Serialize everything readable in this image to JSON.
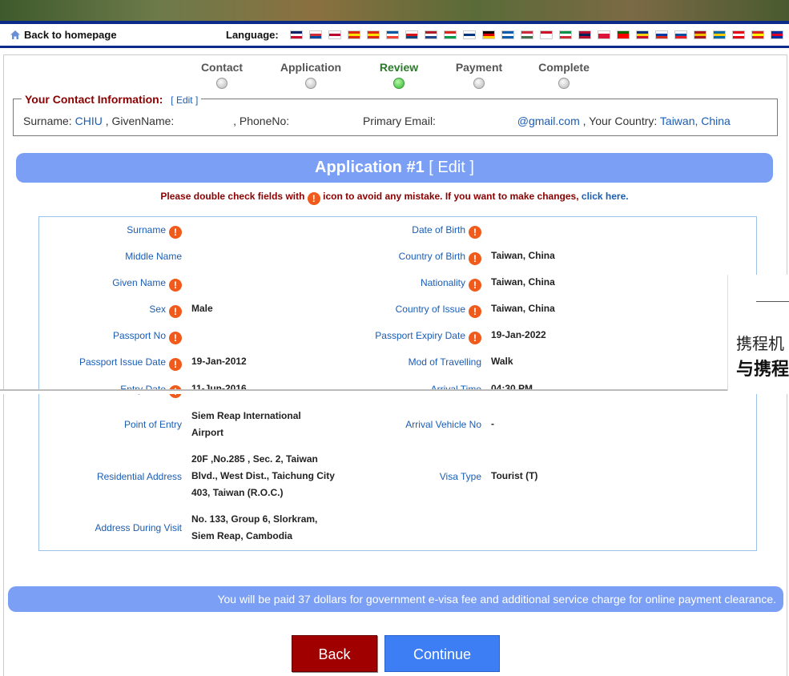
{
  "header": {
    "back_home": "Back to homepage",
    "language_label": "Language:",
    "flags": [
      {
        "name": "uk",
        "c": [
          "#012169",
          "#ffffff",
          "#c8102e"
        ]
      },
      {
        "name": "korea",
        "c": [
          "#ffffff",
          "#cd2e3a",
          "#0047a0"
        ]
      },
      {
        "name": "japan",
        "c": [
          "#ffffff",
          "#bc002d",
          "#ffffff"
        ]
      },
      {
        "name": "china",
        "c": [
          "#de2910",
          "#ffde00",
          "#de2910"
        ]
      },
      {
        "name": "china-traditional",
        "c": [
          "#de2910",
          "#ffde00",
          "#de2910"
        ]
      },
      {
        "name": "france",
        "c": [
          "#0055a4",
          "#ffffff",
          "#ef4135"
        ]
      },
      {
        "name": "czech",
        "c": [
          "#ffffff",
          "#d7141a",
          "#11457e"
        ]
      },
      {
        "name": "netherlands",
        "c": [
          "#ae1c28",
          "#ffffff",
          "#21468b"
        ]
      },
      {
        "name": "basque",
        "c": [
          "#d52b1e",
          "#ffffff",
          "#009b48"
        ]
      },
      {
        "name": "finland",
        "c": [
          "#ffffff",
          "#003580",
          "#ffffff"
        ]
      },
      {
        "name": "germany",
        "c": [
          "#000000",
          "#dd0000",
          "#ffce00"
        ]
      },
      {
        "name": "greece",
        "c": [
          "#0d5eaf",
          "#ffffff",
          "#0d5eaf"
        ]
      },
      {
        "name": "hungary",
        "c": [
          "#cd2a3e",
          "#ffffff",
          "#436f4d"
        ]
      },
      {
        "name": "indonesia",
        "c": [
          "#ce1126",
          "#ffffff",
          "#ffffff"
        ]
      },
      {
        "name": "italy",
        "c": [
          "#009246",
          "#ffffff",
          "#ce2b37"
        ]
      },
      {
        "name": "norway",
        "c": [
          "#ba0c2f",
          "#00205b",
          "#ba0c2f"
        ]
      },
      {
        "name": "poland",
        "c": [
          "#ffffff",
          "#dc143c",
          "#dc143c"
        ]
      },
      {
        "name": "portugal",
        "c": [
          "#006600",
          "#ff0000",
          "#ff0000"
        ]
      },
      {
        "name": "romania",
        "c": [
          "#002b7f",
          "#fcd116",
          "#ce1126"
        ]
      },
      {
        "name": "russia",
        "c": [
          "#ffffff",
          "#0039a6",
          "#d52b1e"
        ]
      },
      {
        "name": "slovakia",
        "c": [
          "#ffffff",
          "#0b4ea2",
          "#ee1c25"
        ]
      },
      {
        "name": "spain",
        "c": [
          "#aa151b",
          "#f1bf00",
          "#aa151b"
        ]
      },
      {
        "name": "sweden",
        "c": [
          "#006aa7",
          "#fecc00",
          "#006aa7"
        ]
      },
      {
        "name": "turkey",
        "c": [
          "#e30a17",
          "#ffffff",
          "#e30a17"
        ]
      },
      {
        "name": "vietnam",
        "c": [
          "#da251d",
          "#ffff00",
          "#da251d"
        ]
      },
      {
        "name": "cambodia",
        "c": [
          "#032ea1",
          "#e00025",
          "#032ea1"
        ]
      }
    ]
  },
  "steps": [
    "Contact",
    "Application",
    "Review",
    "Payment",
    "Complete"
  ],
  "contact": {
    "legend": "Your Contact Information:",
    "edit": "[ Edit ]",
    "surname_label": "Surname:",
    "surname": "CHIU",
    "given_label": ", GivenName:",
    "phone_label": ", PhoneNo:",
    "email_label": "Primary Email:",
    "email_domain": "@gmail.com",
    "country_label": ", Your Country:",
    "country": "Taiwan, China"
  },
  "application": {
    "title": "Application #1",
    "edit": "[ Edit ]",
    "notice_pre": "Please double check fields with",
    "notice_post": "icon to avoid any mistake. If you want to make changes,",
    "click_here": "click here.",
    "warn_glyph": "!"
  },
  "fields": {
    "surname": {
      "label": "Surname",
      "value": ""
    },
    "middle_name": {
      "label": "Middle Name",
      "value": ""
    },
    "given_name": {
      "label": "Given Name",
      "value": ""
    },
    "sex": {
      "label": "Sex",
      "value": "Male"
    },
    "passport_no": {
      "label": "Passport No",
      "value": ""
    },
    "passport_issue": {
      "label": "Passport Issue Date",
      "value": "19-Jan-2012"
    },
    "entry_date": {
      "label": "Entry Date",
      "value": "11-Jun-2016"
    },
    "point_of_entry": {
      "label": "Point of Entry",
      "value": "Siem Reap International Airport"
    },
    "residential": {
      "label": "Residential Address",
      "value": "20F ,No.285 , Sec. 2, Taiwan Blvd., West Dist., Taichung City 403, Taiwan (R.O.C.)"
    },
    "address_visit": {
      "label": "Address During Visit",
      "value": "No. 133, Group 6, Slorkram, Siem Reap, Cambodia"
    },
    "dob": {
      "label": "Date of Birth",
      "value": ""
    },
    "country_birth": {
      "label": "Country of Birth",
      "value": "Taiwan, China"
    },
    "nationality": {
      "label": "Nationality",
      "value": "Taiwan, China"
    },
    "country_issue": {
      "label": "Country of Issue",
      "value": "Taiwan, China"
    },
    "passport_expiry": {
      "label": "Passport Expiry Date",
      "value": "19-Jan-2022"
    },
    "mod_travel": {
      "label": "Mod of Travelling",
      "value": "Walk"
    },
    "arrival_time": {
      "label": "Arrival Time",
      "value": "04:30 PM"
    },
    "arrival_vehicle": {
      "label": "Arrival Vehicle No",
      "value": "-"
    },
    "visa_type": {
      "label": "Visa Type",
      "value": "Tourist (T)"
    }
  },
  "ad": {
    "line1": "携程机",
    "line2": "与携程"
  },
  "payment_notice": "You will be paid 37 dollars for government e-visa fee and additional service charge for online payment clearance.",
  "buttons": {
    "back": "Back",
    "continue": "Continue"
  }
}
